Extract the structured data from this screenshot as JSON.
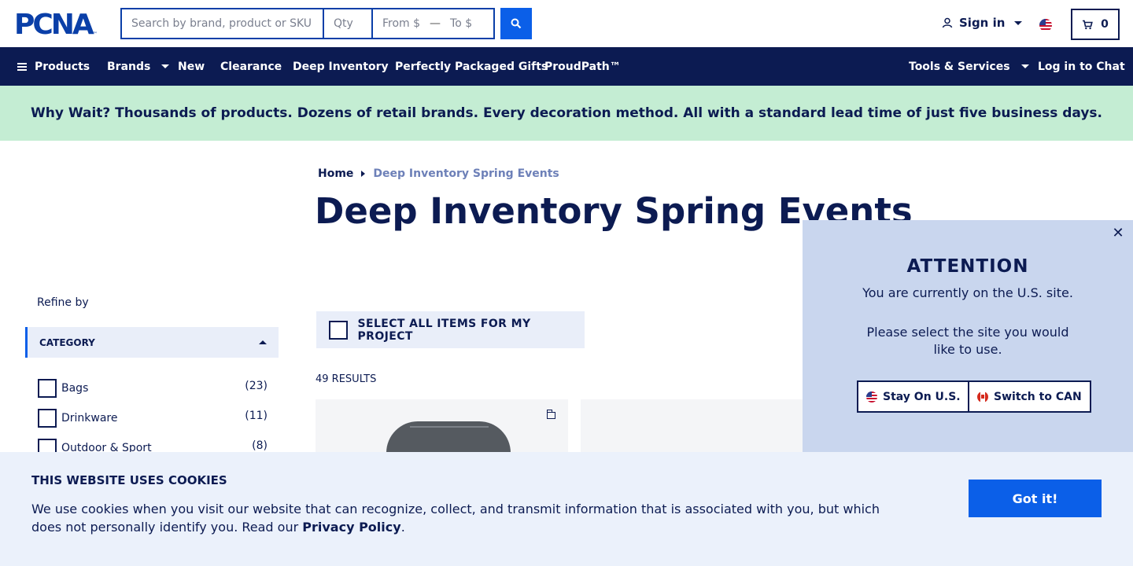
{
  "header": {
    "logo_text": "PCNA",
    "logo_tm": "™",
    "search": {
      "sku_placeholder": "Search by brand, product or SKU",
      "qty_placeholder": "Qty",
      "from_placeholder": "From $",
      "to_placeholder": "To $",
      "dash": "—"
    },
    "sign_in": "Sign in",
    "cart_count": "0"
  },
  "nav": {
    "products": "Products",
    "brands": "Brands",
    "new": "New",
    "clearance": "Clearance",
    "deep_inventory": "Deep Inventory",
    "gifts": "Perfectly Packaged Gifts",
    "proudpath": "ProudPath™",
    "tools": "Tools & Services",
    "chat": "Log in to Chat"
  },
  "promo": {
    "text": "Why Wait? Thousands of products. Dozens of retail brands. Every decoration method. All with a standard lead time of just five business days."
  },
  "breadcrumb": {
    "home": "Home",
    "current": "Deep Inventory Spring Events"
  },
  "page_title": "Deep Inventory Spring Events",
  "sidebar": {
    "refine_by": "Refine by",
    "category_header": "CATEGORY",
    "categories": [
      {
        "label": "Bags",
        "count": "(23)"
      },
      {
        "label": "Drinkware",
        "count": "(11)"
      },
      {
        "label": "Outdoor & Sport",
        "count": "(8)"
      }
    ]
  },
  "content": {
    "select_all": "SELECT ALL ITEMS FOR MY PROJECT",
    "results": "49 RESULTS"
  },
  "attention": {
    "close": "✕",
    "title": "ATTENTION",
    "message": "You are currently on the U.S. site.",
    "prompt": "Please select the site you would like to use.",
    "stay_button": "Stay On U.S.",
    "switch_button": "Switch to CAN"
  },
  "cookies": {
    "title": "THIS WEBSITE USES COOKIES",
    "text": "We use cookies when you visit our website that can recognize, collect, and transmit information that is associated with you, but which does not personally identify you. Read our",
    "link": "Privacy Policy",
    "period": ".",
    "button": "Got it!"
  },
  "colors": {
    "navy": "#0c1b52",
    "brand_blue": "#0a3fa8",
    "action_blue": "#0b5fe8",
    "promo_green": "#c4edd3",
    "popup_blue": "#c9d6ee",
    "cookie_bg": "#ebf1fb"
  }
}
